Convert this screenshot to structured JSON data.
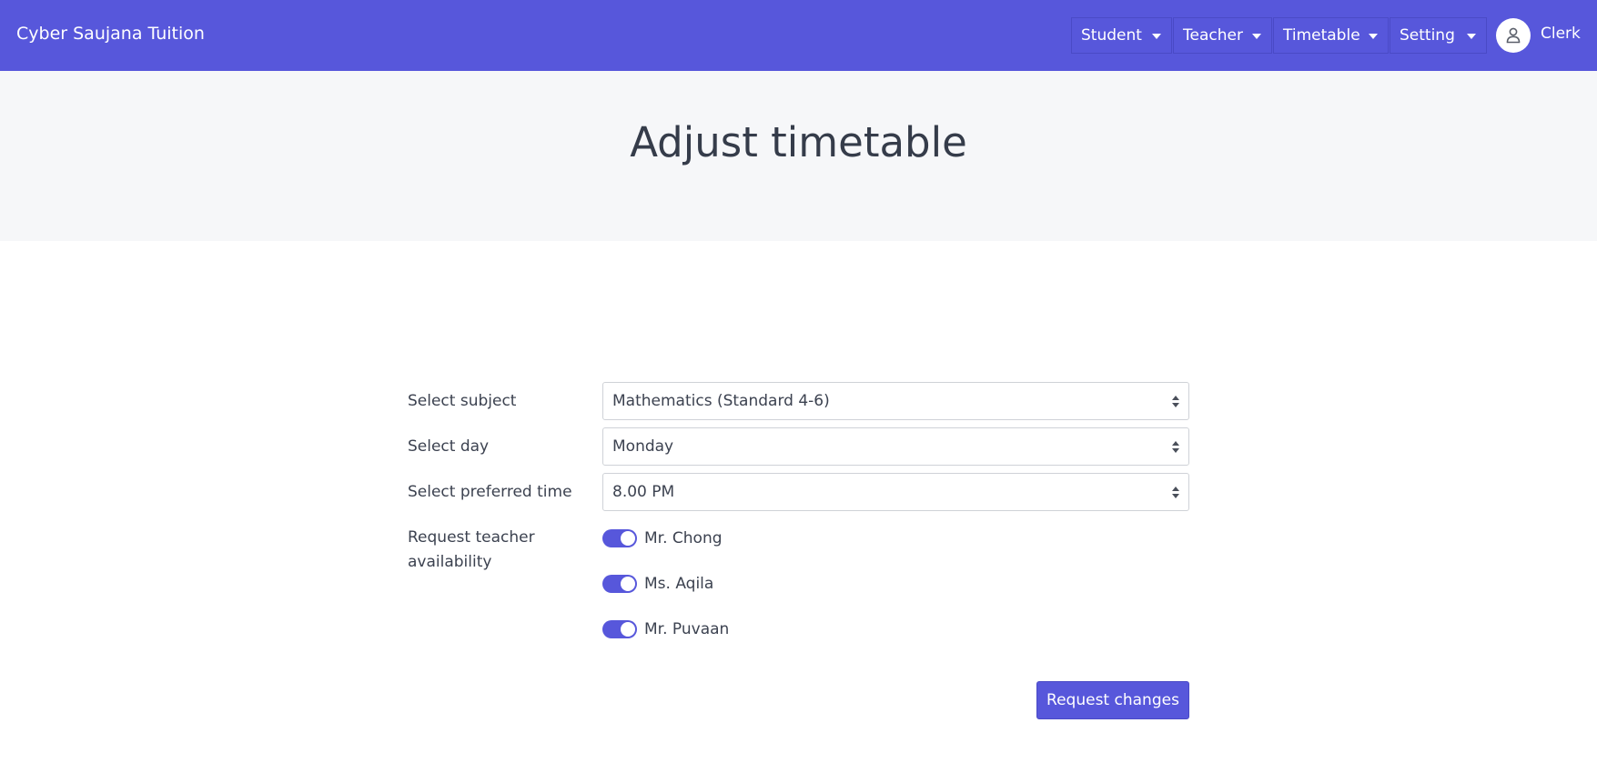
{
  "navbar": {
    "brand": "Cyber Saujana Tuition",
    "menus": [
      {
        "label": "Student"
      },
      {
        "label": "Teacher"
      },
      {
        "label": "Timetable"
      },
      {
        "label": "Setting"
      }
    ],
    "user": {
      "name": "Clerk",
      "icon": "user-icon"
    }
  },
  "page": {
    "title": "Adjust timetable"
  },
  "form": {
    "subject": {
      "label": "Select subject",
      "value": "Mathematics (Standard 4-6)"
    },
    "day": {
      "label": "Select day",
      "value": "Monday"
    },
    "time": {
      "label": "Select preferred time",
      "value": "8.00 PM"
    },
    "teachers": {
      "label_line1": "Request teacher",
      "label_line2": "availability",
      "options": [
        {
          "name": "Mr. Chong",
          "enabled": true
        },
        {
          "name": "Ms. Aqila",
          "enabled": true
        },
        {
          "name": "Mr. Puvaan",
          "enabled": true
        }
      ]
    },
    "submit_label": "Request changes"
  },
  "colors": {
    "accent": "#5757db",
    "hero_bg": "#f6f7f9"
  }
}
